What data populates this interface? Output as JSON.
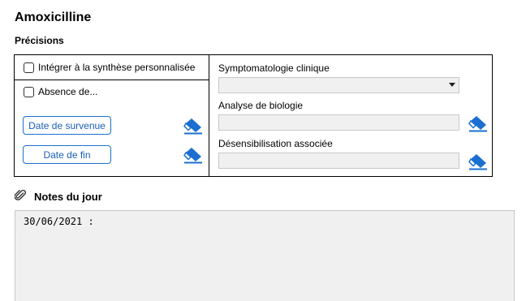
{
  "header": {
    "title": "Amoxicilline",
    "subtitle": "Précisions"
  },
  "left": {
    "checkbox_synthesis": {
      "label": "Intégrer à la synthèse personnalisée",
      "checked": false
    },
    "checkbox_absence": {
      "label": "Absence de...",
      "checked": false
    },
    "btn_start_label": "Date de survenue",
    "btn_end_label": "Date de fin"
  },
  "right": {
    "symptom_label": "Symptomatologie clinique",
    "symptom_value": "",
    "biology_label": "Analyse de biologie",
    "biology_value": "",
    "desens_label": "Désensibilisation associée",
    "desens_value": ""
  },
  "notes": {
    "title": "Notes du jour",
    "content": "30/06/2021 :"
  },
  "colors": {
    "accent": "#1a6fd0",
    "field_bg": "#f0f0f0"
  },
  "icons": {
    "eraser": "eraser-icon",
    "paperclip": "paperclip-icon",
    "dropdown": "chevron-down-icon"
  }
}
